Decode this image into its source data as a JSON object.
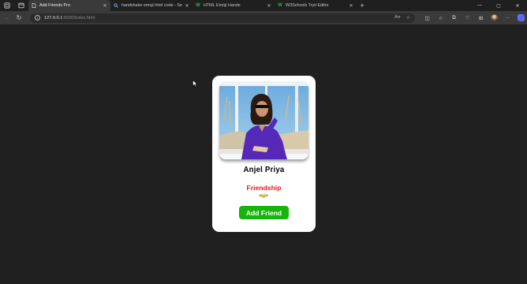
{
  "browser": {
    "tabs": [
      {
        "title": "Add Friends Pro",
        "favicon": "page-icon",
        "active": true
      },
      {
        "title": "handshake emoji html code - Se",
        "favicon": "search-icon",
        "active": false
      },
      {
        "title": "HTML Emoji Hands",
        "favicon": "w3schools-icon",
        "active": false
      },
      {
        "title": "W3Schools Tryit Editor",
        "favicon": "w3schools-icon",
        "active": false
      }
    ],
    "new_tab_label": "+",
    "window_controls": {
      "minimize": "—",
      "maximize": "▢",
      "close": "✕"
    },
    "url": {
      "host": "127.0.0.1",
      "rest": ":5500/index.html"
    }
  },
  "card": {
    "name": "Anjel Priya",
    "relation": "Friendship",
    "relation_icon": "handshake-icon",
    "button_label": "Add Friend"
  },
  "colors": {
    "page_bg": "#202020",
    "card_bg": "#ffffff",
    "relation_text": "#e4161f",
    "button_bg": "#15b50b",
    "button_text": "#ffffff"
  }
}
